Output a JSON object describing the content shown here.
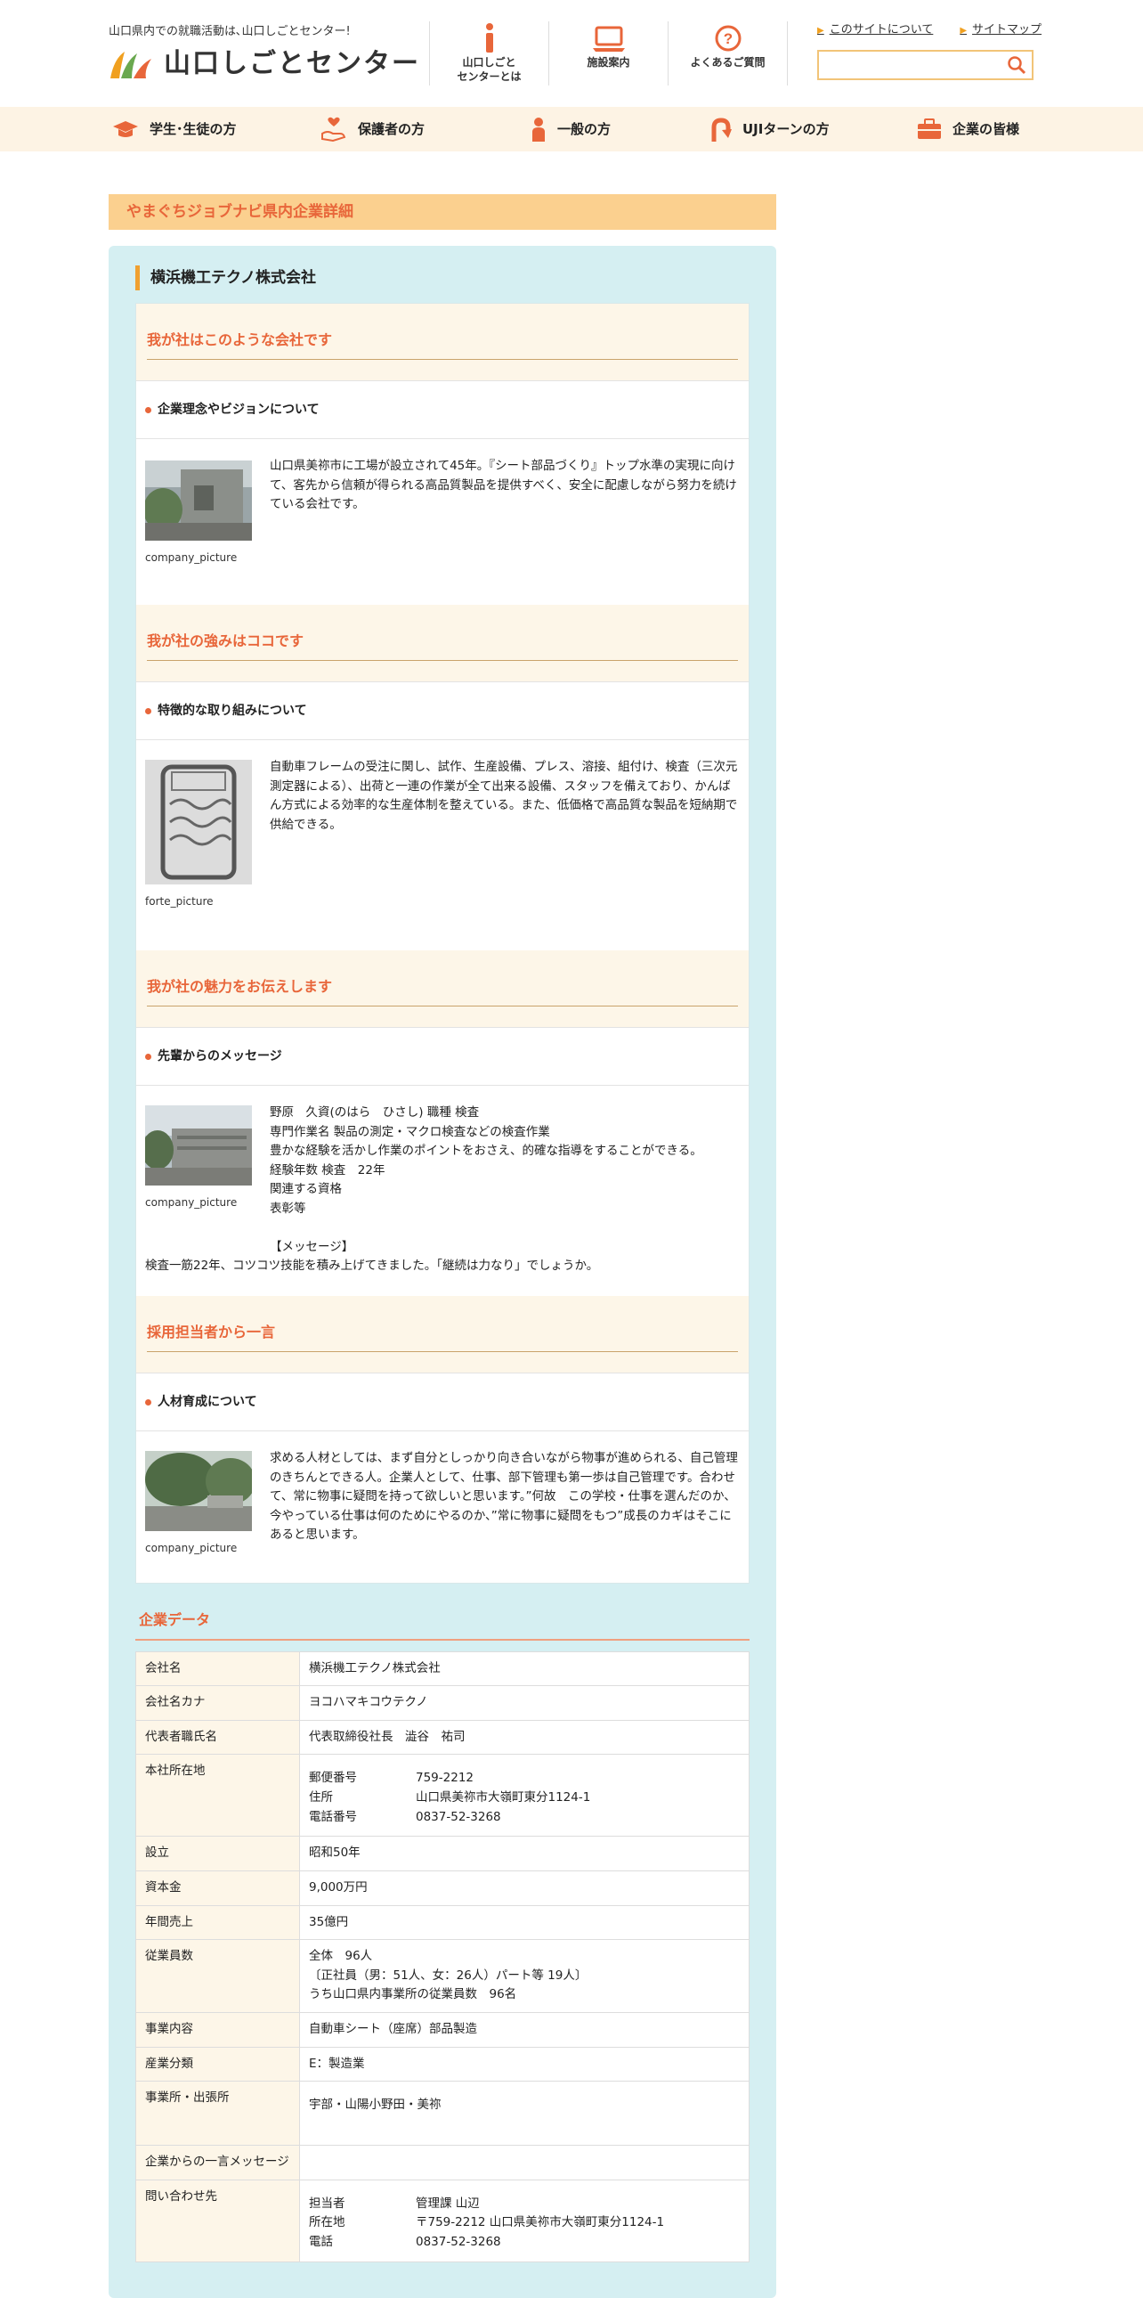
{
  "header": {
    "tagline": "山口県内での就職活動は､山口しごとセンター!",
    "logo_text": "山口しごとセンター",
    "nav": [
      {
        "icon": "info-icon",
        "label": "山口しごと\nセンターとは"
      },
      {
        "icon": "laptop-icon",
        "label": "施設案内"
      },
      {
        "icon": "question-icon",
        "label": "よくあるご質問"
      }
    ],
    "links": [
      "このサイトについて",
      "サイトマップ"
    ],
    "search": {
      "placeholder": ""
    }
  },
  "global_nav": [
    {
      "icon": "graduation-cap-icon",
      "label": "学生･生徒の方"
    },
    {
      "icon": "hand-heart-icon",
      "label": "保護者の方"
    },
    {
      "icon": "person-icon",
      "label": "一般の方"
    },
    {
      "icon": "u-turn-icon",
      "label": "UJIターンの方"
    },
    {
      "icon": "briefcase-icon",
      "label": "企業の皆様"
    }
  ],
  "page_title": "やまぐちジョブナビ県内企業詳細",
  "company_name": "横浜機工テクノ株式会社",
  "sections": [
    {
      "title": "我が社はこのような会社です",
      "subtitle": "企業理念やビジョンについて",
      "caption": "company_picture",
      "text": "山口県美祢市に工場が設立されて45年。『シート部品づくり』トップ水準の実現に向けて、客先から信頼が得られる高品質製品を提供すべく、安全に配慮しながら努力を続けている会社です。"
    },
    {
      "title": "我が社の強みはココです",
      "subtitle": "特徴的な取り組みについて",
      "caption": "forte_picture",
      "text": "自動車フレームの受注に関し、試作、生産設備、プレス、溶接、組付け、検査（三次元測定器による）、出荷と一連の作業が全て出来る設備、スタッフを備えており、かんばん方式による効率的な生産体制を整えている。また、低価格で高品質な製品を短納期で供給できる。"
    },
    {
      "title": "我が社の魅力をお伝えします",
      "subtitle": "先輩からのメッセージ",
      "caption": "company_picture",
      "lines": [
        "野原　久資(のはら　ひさし) 職種 検査",
        "専門作業名 製品の測定・マクロ検査などの検査作業",
        "豊かな経験を活かし作業のポイントをおさえ、的確な指導をすることができる。",
        "経験年数 検査　22年",
        "関連する資格",
        "表彰等",
        "",
        "【メッセージ】"
      ],
      "trailing": "検査一筋22年、コツコツ技能を積み上げてきました。「継続は力なり」でしょうか。"
    },
    {
      "title": "採用担当者から一言",
      "subtitle": "人材育成について",
      "caption": "company_picture",
      "text": "求める人材としては、まず自分としっかり向き合いながら物事が進められる、自己管理のきちんとできる人。企業人として、仕事、部下管理も第一歩は自己管理です。合わせて、常に物事に疑問を持って欲しいと思います。”何故　この学校・仕事を選んだのか、今やっている仕事は何のためにやるのか、”常に物事に疑問をもつ”成長のカギはそこにあると思います。"
    }
  ],
  "company_data": {
    "title": "企業データ",
    "rows": [
      {
        "label": "会社名",
        "value": "横浜機工テクノ株式会社"
      },
      {
        "label": "会社名カナ",
        "value": "ヨコハマキコウテクノ"
      },
      {
        "label": "代表者職氏名",
        "value": "代表取締役社長　澁谷　祐司"
      },
      {
        "label": "本社所在地",
        "sub": [
          [
            "郵便番号",
            "759-2212"
          ],
          [
            "住所",
            "山口県美祢市大嶺町東分1124-1"
          ],
          [
            "電話番号",
            "0837-52-3268"
          ]
        ]
      },
      {
        "label": "設立",
        "value": "昭和50年"
      },
      {
        "label": "資本金",
        "value": "9,000万円"
      },
      {
        "label": "年間売上",
        "value": "35億円"
      },
      {
        "label": "従業員数",
        "lines": [
          "全体　96人",
          "〔正社員（男：51人、女：26人）パート等 19人〕",
          "うち山口県内事業所の従業員数　96名"
        ]
      },
      {
        "label": "事業内容",
        "value": "自動車シート（座席）部品製造"
      },
      {
        "label": "産業分類",
        "value": "E：製造業"
      },
      {
        "label": "事業所・出張所",
        "value": "宇部・山陽小野田・美祢"
      },
      {
        "label": "企業からの一言メッセージ",
        "value": ""
      },
      {
        "label": "問い合わせ先",
        "sub": [
          [
            "担当者",
            "管理課 山辺"
          ],
          [
            "所在地",
            "〒759-2212 山口県美祢市大嶺町東分1124-1"
          ],
          [
            "電話",
            "0837-52-3268"
          ]
        ]
      }
    ]
  },
  "colors": {
    "accent": "#e8663a",
    "nav_bg": "#fdf3e4",
    "panel_bg": "#d5eff2",
    "head_bg": "#fbd08f"
  }
}
